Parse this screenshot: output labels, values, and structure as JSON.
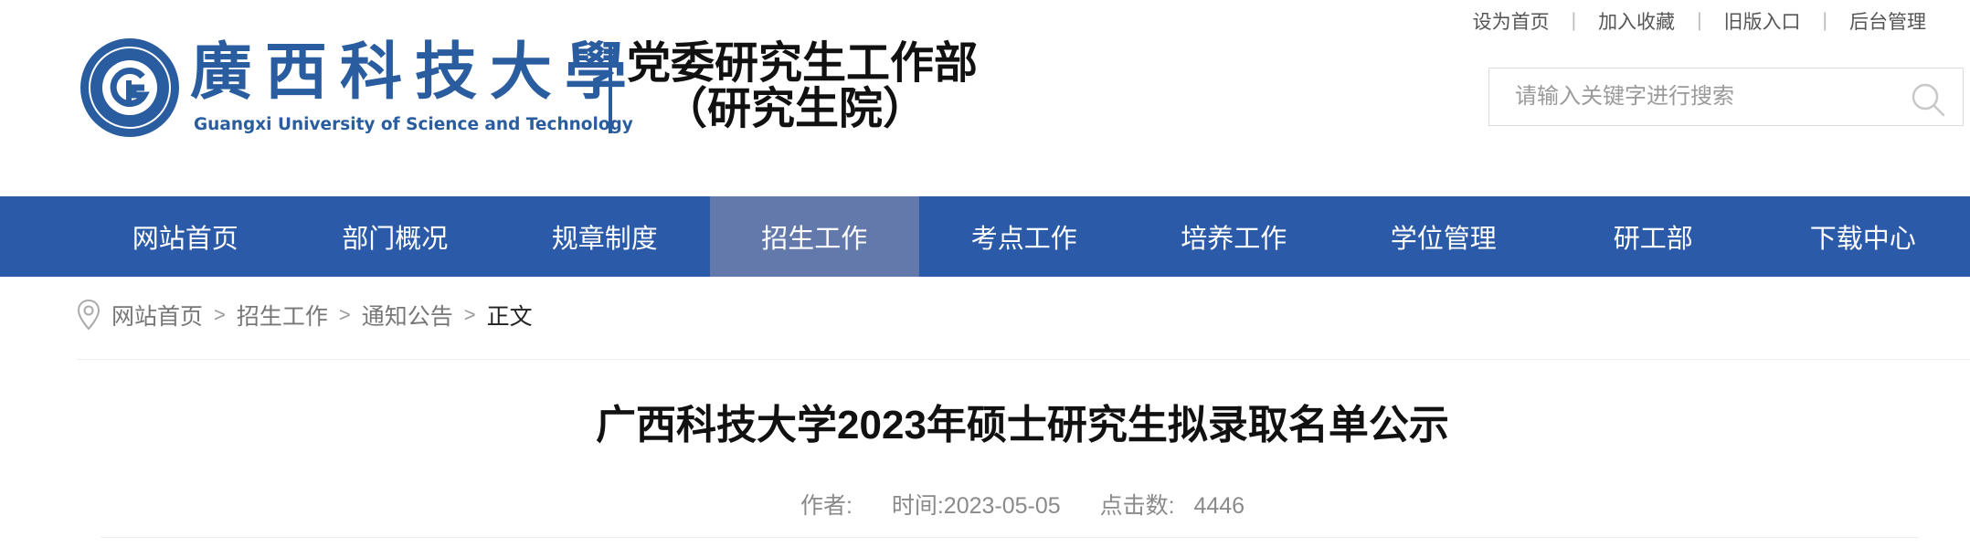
{
  "header": {
    "school_name_cn": "廣西科技大學",
    "school_name_en": "Guangxi University of Science and Technology",
    "dept_title": "党委研究生工作部",
    "dept_subtitle": "（研究生院）",
    "brand_color": "#2a5d9f"
  },
  "top_links": [
    "设为首页",
    "加入收藏",
    "旧版入口",
    "后台管理"
  ],
  "search": {
    "placeholder": "请输入关键字进行搜索",
    "value": "",
    "icon": "search-icon"
  },
  "nav": {
    "items": [
      "网站首页",
      "部门概况",
      "规章制度",
      "招生工作",
      "考点工作",
      "培养工作",
      "学位管理",
      "研工部",
      "下载中心"
    ],
    "active": "招生工作",
    "bg_color": "#2b5aa8",
    "active_color": "#6379ab"
  },
  "breadcrumb": {
    "icon": "location-pin-icon",
    "links": [
      "网站首页",
      "招生工作",
      "通知公告"
    ],
    "current": "正文"
  },
  "article": {
    "title": "广西科技大学2023年硕士研究生拟录取名单公示",
    "author_label": "作者:",
    "author": "",
    "date_label": "时间:",
    "date": "2023-05-05",
    "clicks_label": "点击数:",
    "clicks": "4446"
  }
}
